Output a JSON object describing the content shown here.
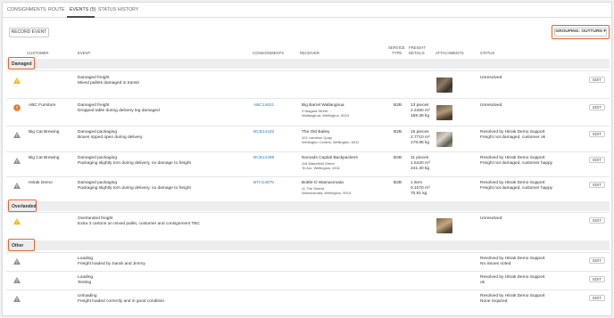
{
  "tabs": [
    {
      "label": "CONSIGNMENTS"
    },
    {
      "label": "ROUTE"
    },
    {
      "label": "EVENTS (5)"
    },
    {
      "label": "STATUS HISTORY"
    }
  ],
  "toolbar": {
    "record_event_label": "RECORD EVENT",
    "grouping_label": "GROUPING: OUTTURN ▾"
  },
  "columns": {
    "customer": "CUSTOMER",
    "event": "EVENT",
    "consignments": "CONSIGNMENTS",
    "receiver": "RECEIVER",
    "service_type": [
      "SERVICE",
      "TYPE"
    ],
    "freight_details": [
      "FREIGHT",
      "DETAILS"
    ],
    "attachments": "ATTACHMENTS",
    "status": "STATUS"
  },
  "groups": [
    {
      "label": "Damaged"
    },
    {
      "label": "Overlanded"
    },
    {
      "label": "Other"
    }
  ],
  "rows": [
    {
      "customer": "",
      "event_title": "Damaged freight",
      "event_desc": "Mixed pallets damaged in transit",
      "consignment": "",
      "receiver": [],
      "service": "",
      "freight": [],
      "status": [
        "Unresolved"
      ],
      "edit": "EDIT"
    },
    {
      "customer": "ABC Furniture",
      "event_title": "Damaged freight",
      "event_desc": "Dropped table during delivery leg damaged",
      "consignment": "ABC14621",
      "receiver": [
        "Big Barrel Wallangirua",
        "3 Niagara Street",
        "Wallangirua, Wellington, 5024"
      ],
      "service": "B2B",
      "freight": [
        "13 pieces",
        "2.2450 m³",
        "159.38 kg"
      ],
      "status": [
        "Unresolved"
      ],
      "edit": "EDIT"
    },
    {
      "customer": "Big Cat Brewing",
      "event_title": "Damaged packaging",
      "event_desc": "Boxes ripped open during delivery",
      "consignment": "BCB14432",
      "receiver": [
        "The Old Bailey",
        "101 Lambton Quay",
        "Wellington Central, Wellington, 6011"
      ],
      "service": "B2B",
      "freight": [
        "15 pieces",
        "2.7710 m³",
        "178.85 kg"
      ],
      "status": [
        "Resolved by Hitrak Demo Support",
        "Freight not damaged, customer ok"
      ],
      "edit": "EDIT"
    },
    {
      "customer": "Big Cat Brewing",
      "event_title": "Damaged packaging",
      "event_desc": "Packaging slightly torn during delivery, no damage to freight",
      "consignment": "BCB14499",
      "receiver": [
        "Nomads Capital Backpackers",
        "118 Wakefield Street",
        "Te Aro, Wellington, 6011"
      ],
      "service": "B2B",
      "freight": [
        "11 pieces",
        "1.5420 m³",
        "241.30 kg"
      ],
      "status": [
        "Resolved by Hitrak Demo Support",
        "Freight not damaged, customer happy"
      ],
      "edit": "EDIT"
    },
    {
      "customer": "Hitrak Demo",
      "event_title": "Damaged packaging",
      "event_desc": "Packaging slightly torn during delivery, no damage to freight",
      "consignment": "BTH14875",
      "receiver": [
        "Bottle-O Wainuiomata",
        "11 The Strand",
        "Wainuiomata, Wellington, 5014"
      ],
      "service": "B2B",
      "freight": [
        "1 item",
        "0.1070 m³",
        "70.81 kg"
      ],
      "status": [
        "Resolved by Hitrak Demo Support",
        "Freight not damaged, customer happy"
      ],
      "edit": "EDIT"
    },
    {
      "customer": "",
      "event_title": "Overlanded freight",
      "event_desc": "Extra 3 cartons on mixed pallet, customer and consignment TBC",
      "consignment": "",
      "receiver": [],
      "service": "",
      "freight": [],
      "status": [
        "Unresolved"
      ],
      "edit": "EDIT"
    },
    {
      "customer": "",
      "event_title": "Loading",
      "event_desc": "Freight loaded by Sarah and Jimmy",
      "consignment": "",
      "receiver": [],
      "service": "",
      "freight": [],
      "status": [
        "Resolved by Hitrak Demo Support",
        "No issues noted"
      ],
      "edit": "EDIT"
    },
    {
      "customer": "",
      "event_title": "Loading",
      "event_desc": "Testing",
      "consignment": "",
      "receiver": [],
      "service": "",
      "freight": [],
      "status": [
        "Resolved by Hitrak Demo Support",
        "ok"
      ],
      "edit": "EDIT"
    },
    {
      "customer": "",
      "event_title": "Unloading",
      "event_desc": "Freight loaded correctly and in good condition",
      "consignment": "",
      "receiver": [],
      "service": "",
      "freight": [],
      "status": [
        "Resolved by Hitrak Demo Support",
        "None required"
      ],
      "edit": "EDIT"
    }
  ],
  "icons": {
    "warning": "warning-icon",
    "alert": "alert-circle-icon",
    "info": "info-icon",
    "photo": "photo-icon",
    "dropdown": "chevron-down-icon"
  },
  "colors": {
    "accent": "#e8622a",
    "link": "#2f7fbf",
    "warning": "#f5b800",
    "alert": "#e8762a",
    "neutral_icon": "#8a8f94",
    "group_bg": "#ebedef"
  }
}
